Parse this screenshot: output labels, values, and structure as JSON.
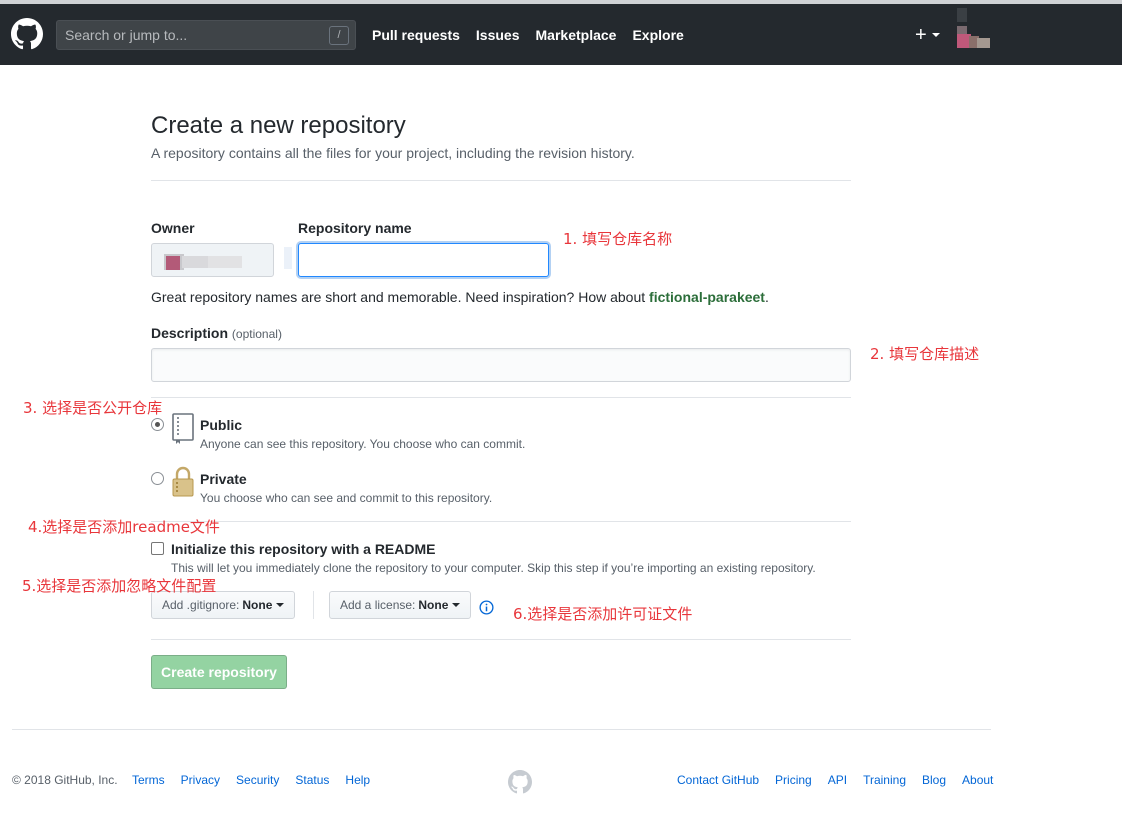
{
  "header": {
    "search_placeholder": "Search or jump to...",
    "search_shortcut": "/",
    "nav": [
      "Pull requests",
      "Issues",
      "Marketplace",
      "Explore"
    ],
    "plus": "+"
  },
  "page": {
    "title": "Create a new repository",
    "subtitle": "A repository contains all the files for your project, including the revision history."
  },
  "form": {
    "owner_label": "Owner",
    "repo_label": "Repository name",
    "repo_value": "",
    "hint_prefix": "Great repository names are short and memorable. Need inspiration? How about ",
    "hint_suggestion": "fictional-parakeet",
    "hint_suffix": ".",
    "description_label": "Description",
    "description_optional": "(optional)",
    "description_value": "",
    "public_title": "Public",
    "public_note": "Anyone can see this repository. You choose who can commit.",
    "private_title": "Private",
    "private_note": "You choose who can see and commit to this repository.",
    "readme_title": "Initialize this repository with a README",
    "readme_note": "This will let you immediately clone the repository to your computer. Skip this step if you’re importing an existing repository.",
    "gitignore_key": "Add .gitignore:",
    "gitignore_value": "None",
    "license_key": "Add a license:",
    "license_value": "None",
    "create_button": "Create repository",
    "visibility_selected": "public"
  },
  "annotations": {
    "a1": "1.  填写仓库名称",
    "a2": "2.  填写仓库描述",
    "a3": "3.  选择是否公开仓库",
    "a4": "4.选择是否添加readme文件",
    "a5": "5.选择是否添加忽略文件配置",
    "a6": "6.选择是否添加许可证文件"
  },
  "footer": {
    "copyright": "© 2018 GitHub, Inc.",
    "left_links": [
      "Terms",
      "Privacy",
      "Security",
      "Status",
      "Help"
    ],
    "right_links": [
      "Contact GitHub",
      "Pricing",
      "API",
      "Training",
      "Blog",
      "About"
    ]
  },
  "colors": {
    "header_bg": "#24292e",
    "link": "#0366d6",
    "annotation": "#e8363b",
    "create_button_bg": "#94d3a2"
  }
}
